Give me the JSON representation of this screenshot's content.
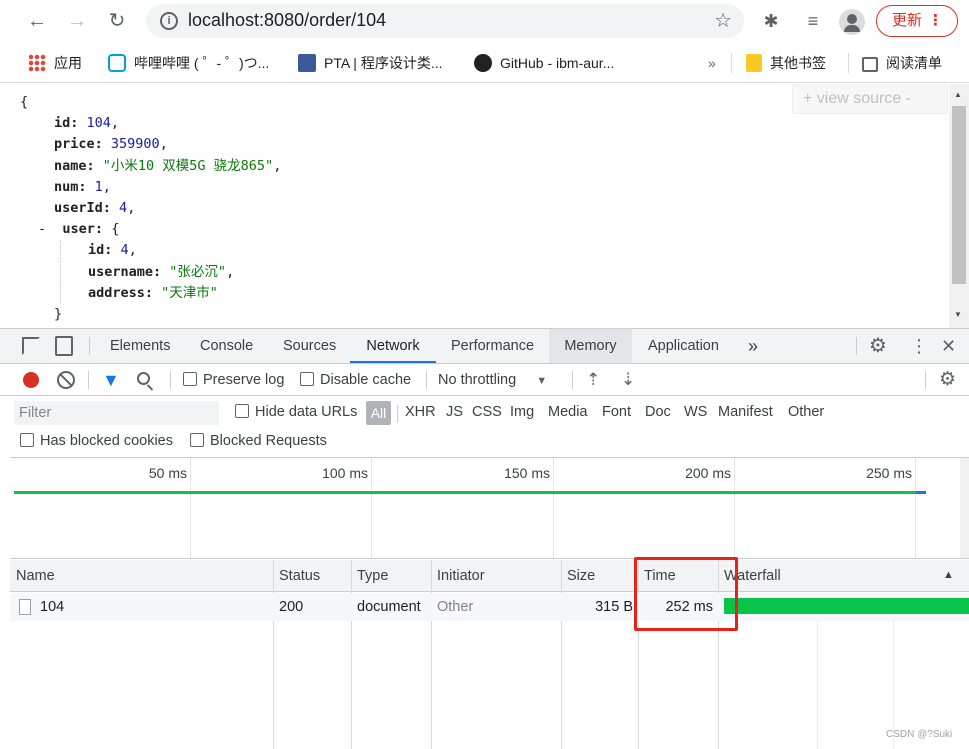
{
  "browser": {
    "url": "localhost:8080/order/104",
    "update_label": "更新",
    "bookmarks": [
      "应用",
      "哔哩哔哩 ( ゜- ゜)つ...",
      "PTA | 程序设计类...",
      "GitHub - ibm-aur...",
      "其他书签",
      "阅读清单"
    ],
    "overflow_label": "»"
  },
  "json_view": {
    "open_brace": "{",
    "fields": [
      {
        "key": "id",
        "value": "104",
        "kind": "number"
      },
      {
        "key": "price",
        "value": "359900",
        "kind": "number"
      },
      {
        "key": "name",
        "value": "\"小米10 双模5G 骁龙865\"",
        "kind": "string"
      },
      {
        "key": "num",
        "value": "1",
        "kind": "number"
      },
      {
        "key": "userId",
        "value": "4",
        "kind": "number"
      }
    ],
    "user_toggle": "-",
    "user_key": "user",
    "user_fields": [
      {
        "key": "id",
        "value": "4",
        "kind": "number"
      },
      {
        "key": "username",
        "value": "\"张必沉\"",
        "kind": "string"
      },
      {
        "key": "address",
        "value": "\"天津市\"",
        "kind": "string"
      }
    ],
    "view_source": "+ view source -"
  },
  "devtools": {
    "tabs": [
      "Elements",
      "Console",
      "Sources",
      "Network",
      "Performance",
      "Memory",
      "Application"
    ],
    "active_tab": "Network",
    "more_tabs": "»",
    "toolbar": {
      "preserve_log": "Preserve log",
      "disable_cache": "Disable cache",
      "throttling": "No throttling"
    },
    "filter": {
      "placeholder": "Filter",
      "hide_data_urls": "Hide data URLs",
      "types": [
        "All",
        "XHR",
        "JS",
        "CSS",
        "Img",
        "Media",
        "Font",
        "Doc",
        "WS",
        "Manifest",
        "Other"
      ],
      "has_blocked_cookies": "Has blocked cookies",
      "blocked_requests": "Blocked Requests"
    },
    "overview_ticks": [
      "50 ms",
      "100 ms",
      "150 ms",
      "200 ms",
      "250 ms"
    ],
    "table": {
      "columns": [
        "Name",
        "Status",
        "Type",
        "Initiator",
        "Size",
        "Time",
        "Waterfall"
      ],
      "rows": [
        {
          "name": "104",
          "status": "200",
          "type": "document",
          "initiator": "Other",
          "size": "315 B",
          "time": "252 ms"
        }
      ]
    }
  },
  "watermark": "CSDN @?Suki",
  "colors": {
    "accent": "#1a73e8",
    "waterfall": "#0ac44a",
    "highlight": "#e8211b",
    "record": "#d93025"
  }
}
